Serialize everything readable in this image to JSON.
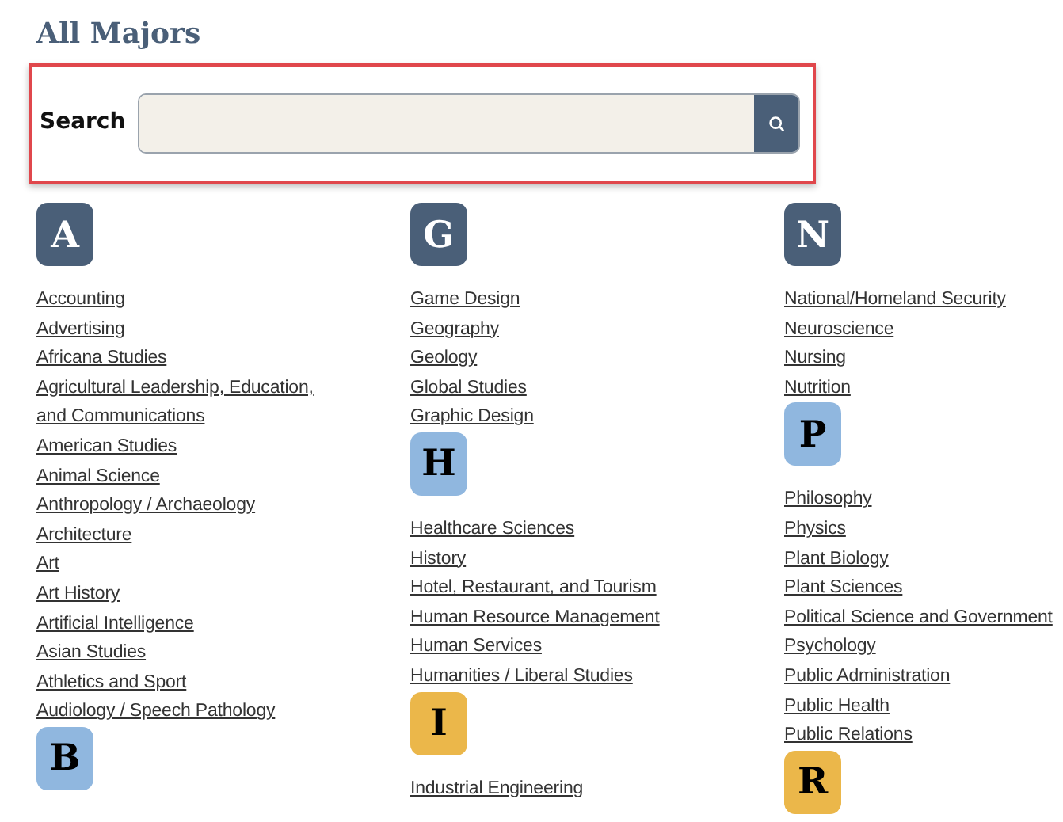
{
  "title": "All Majors",
  "search": {
    "label": "Search"
  },
  "columns": [
    {
      "sections": [
        {
          "letter": "A",
          "color": "#4a5f78",
          "majors": [
            "Accounting",
            "Advertising",
            "Africana Studies",
            "Agricultural Leadership, Education, and Communications",
            "American Studies",
            "Animal Science",
            "Anthropology / Archaeology",
            "Architecture",
            "Art",
            "Art History",
            "Artificial Intelligence",
            "Asian Studies",
            "Athletics and Sport",
            "Audiology / Speech Pathology"
          ]
        },
        {
          "letter": "B",
          "color": "#90b7df"
        }
      ]
    },
    {
      "sections": [
        {
          "letter": "G",
          "color": "#4a5f78",
          "majors": [
            "Game Design",
            "Geography",
            "Geology",
            "Global Studies",
            "Graphic Design"
          ]
        },
        {
          "letter": "H",
          "color": "#90b7df",
          "majors": [
            "Healthcare Sciences",
            "History",
            "Hotel, Restaurant, and Tourism",
            "Human Resource Management",
            "Human Services",
            "Humanities / Liberal Studies"
          ]
        },
        {
          "letter": "I",
          "color": "#ebb74a",
          "majors": [
            "Industrial Engineering"
          ]
        }
      ]
    },
    {
      "sections": [
        {
          "letter": "N",
          "color": "#4a5f78",
          "majors": [
            "National/Homeland Security",
            "Neuroscience",
            "Nursing",
            "Nutrition"
          ]
        },
        {
          "letter": "P",
          "color": "#90b7df",
          "majors": [
            "Philosophy",
            "Physics",
            "Plant Biology",
            "Plant Sciences",
            "Political Science and Government",
            "Psychology",
            "Public Administration",
            "Public Health",
            "Public Relations"
          ]
        },
        {
          "letter": "R",
          "color": "#ebb74a"
        }
      ]
    }
  ]
}
